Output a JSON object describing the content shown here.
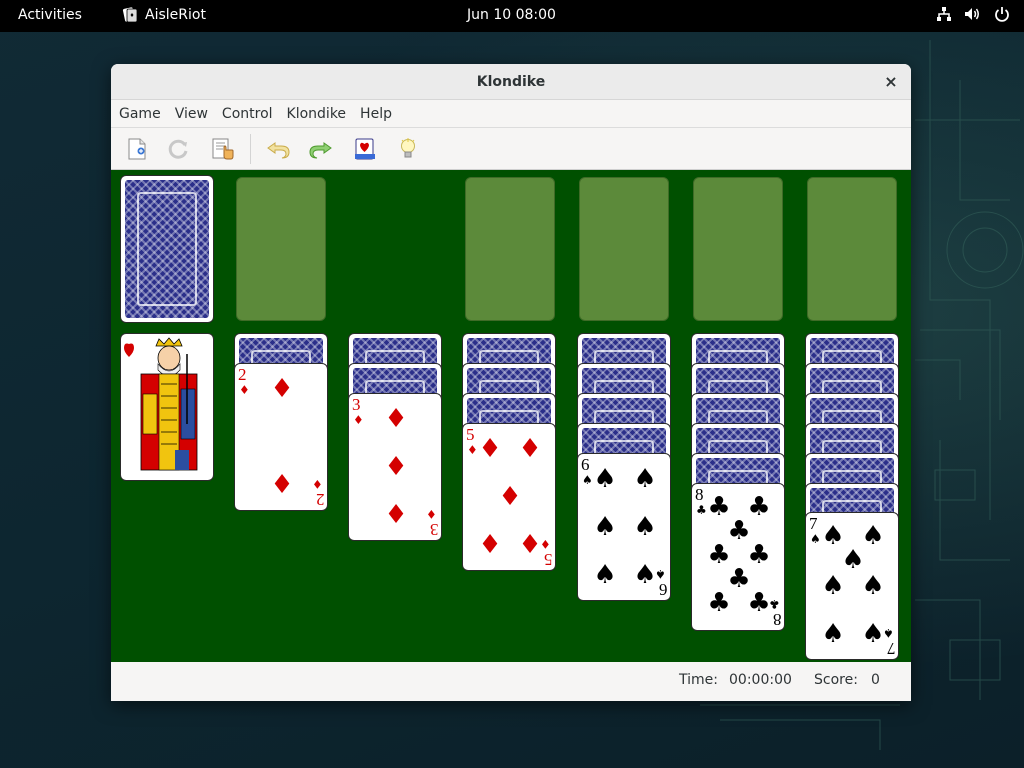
{
  "topbar": {
    "activities": "Activities",
    "app_name": "AisleRiot",
    "clock": "Jun 10  08:00",
    "icons": [
      "network-icon",
      "volume-icon",
      "power-icon"
    ]
  },
  "window": {
    "title": "Klondike",
    "close_glyph": "×"
  },
  "menu": [
    "Game",
    "View",
    "Control",
    "Klondike",
    "Help"
  ],
  "toolbar": {
    "buttons": [
      "new-game-icon",
      "restart-icon",
      "select-game-icon",
      "undo-icon",
      "redo-icon",
      "deal-icon",
      "hint-icon"
    ]
  },
  "colors": {
    "felt": "#005000",
    "slot": "#5c8a3a",
    "card_back": "#2b2f8a",
    "red_suit": "#d40000"
  },
  "game": {
    "stock": "card-back",
    "waste": {
      "rank": "K",
      "suit": "♥"
    },
    "foundations": 4,
    "tableau": [
      {
        "hidden": 1,
        "rank": "2",
        "suit": "♦"
      },
      {
        "hidden": 2,
        "rank": "3",
        "suit": "♦"
      },
      {
        "hidden": 3,
        "rank": "5",
        "suit": "♦"
      },
      {
        "hidden": 4,
        "rank": "6",
        "suit": "♠"
      },
      {
        "hidden": 5,
        "rank": "8",
        "suit": "♣"
      },
      {
        "hidden": 6,
        "rank": "7",
        "suit": "♠"
      }
    ]
  },
  "status": {
    "time_label": "Time:",
    "time_value": "00:00:00",
    "score_label": "Score:",
    "score_value": "0"
  }
}
